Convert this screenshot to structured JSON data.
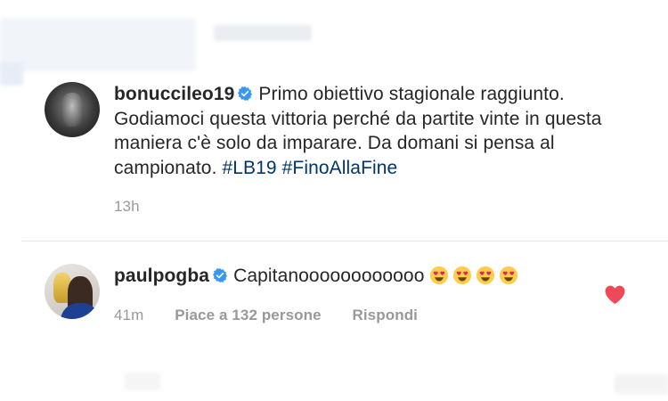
{
  "post": {
    "username": "bonuccileo19",
    "caption": "Primo obiettivo stagionale raggiunto. Godiamoci questa vittoria perché da partite vinte in questa maniera c'è solo da imparare. Da domani si pensa al campionato.",
    "hashtags": [
      "#LB19",
      "#FinoAllaFine"
    ],
    "time": "13h"
  },
  "reply": {
    "username": "paulpogba",
    "text": "Capitanoooooooooooo",
    "emojis": [
      "heart-eyes",
      "heart-eyes",
      "heart-eyes",
      "heart-eyes"
    ],
    "time": "41m",
    "likes": "Piace a 132 persone",
    "reply_label": "Rispondi"
  },
  "colors": {
    "hashtag": "#003569",
    "verified": "#3897f0",
    "like": "#ed4956",
    "meta": "#999999"
  }
}
